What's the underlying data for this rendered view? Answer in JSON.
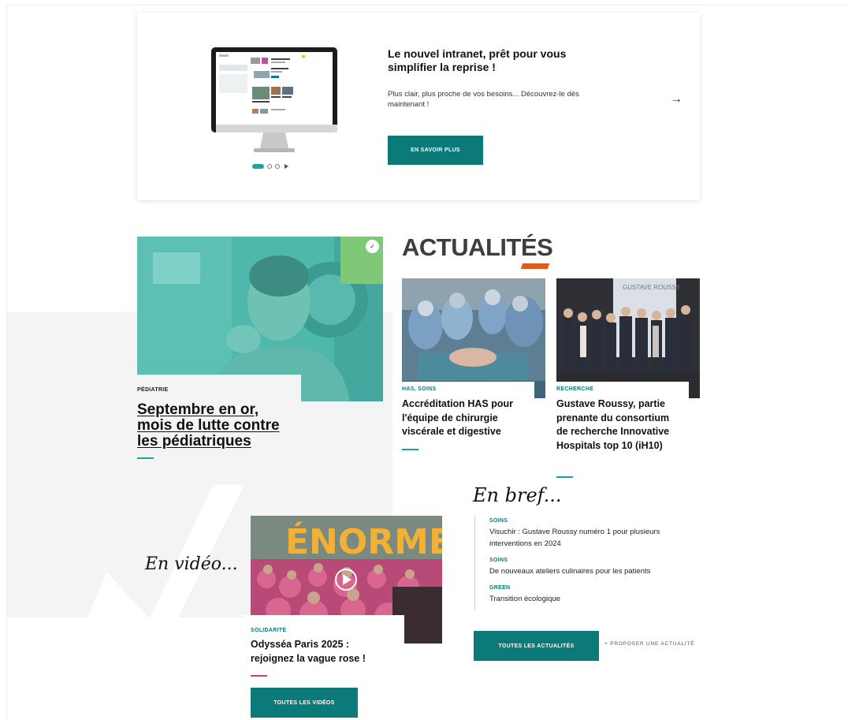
{
  "hero": {
    "title": "Le nouvel intranet, prêt pour vous simplifier la reprise !",
    "description": "Plus clair, plus proche de vos besoins... Découvrez-le dès maintenant !",
    "button": "EN SAVOIR PLUS",
    "arrow": "→"
  },
  "featured": {
    "tag": "PÉDIATRIE",
    "title": "Septembre en or, mois de lutte contre les pédiatriques",
    "badge": "✓"
  },
  "actualites": {
    "heading": "ACTUALITÉS",
    "items": [
      {
        "tag": "HAS, SOINS",
        "title": "Accréditation HAS pour l'équipe de chirurgie viscérale et digestive"
      },
      {
        "tag": "RECHERCHE",
        "title": "Gustave Roussy, partie prenante du consortium de recherche Innovative Hospitals top 10 (iH10)",
        "sign": "GUSTAVE ROUSSY"
      }
    ]
  },
  "bref": {
    "heading": "En bref...",
    "items": [
      {
        "tag": "SOINS",
        "text": "Visuchir : Gustave Roussy numéro 1 pour plusieurs interventions en 2024"
      },
      {
        "tag": "SOINS",
        "text": "De nouveaux ateliers culinaires pour les patients"
      },
      {
        "tag": "GREEN",
        "text": "Transition écologique"
      }
    ],
    "button": "TOUTES LES ACTUALITÉS",
    "propose": "+ PROPOSER UNE ACTUALITÉ"
  },
  "video": {
    "heading": "En vidéo...",
    "banner": "ÉNORME",
    "tag": "SOLIDARITÉ",
    "title": "Odysséa Paris 2025 : rejoignez la vague rose !",
    "button": "TOUTES LES VIDÉOS"
  },
  "colors": {
    "teal": "#0c7a78",
    "accent_teal": "#1aa3a0",
    "orange": "#e0591e",
    "pink": "#d6357f"
  }
}
